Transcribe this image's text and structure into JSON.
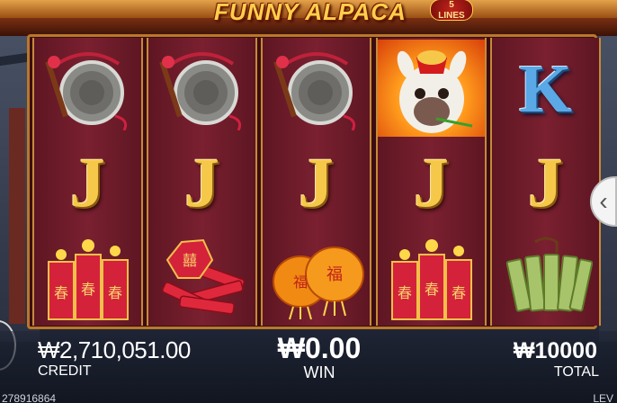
{
  "game": {
    "title": "FUNNY ALPACA",
    "lines_badge": {
      "number": "5",
      "text": "LINES"
    }
  },
  "reels": [
    {
      "symbols": [
        "gong",
        "J",
        "firecrackers"
      ]
    },
    {
      "symbols": [
        "gong",
        "J",
        "firecracker-bundle"
      ]
    },
    {
      "symbols": [
        "gong",
        "J",
        "lanterns"
      ]
    },
    {
      "symbols": [
        "alpaca-wild",
        "J",
        "firecrackers"
      ]
    },
    {
      "symbols": [
        "K",
        "J",
        "jade-tablets"
      ]
    }
  ],
  "hud": {
    "credit_value": "₩2,710,051.00",
    "credit_label": "CREDIT",
    "win_value": "₩0.00",
    "win_label": "WIN",
    "total_value": "₩10000",
    "total_label": "TOTAL"
  },
  "footer": {
    "session_id": "278916864",
    "right_text": "LEV"
  },
  "colors": {
    "gold": "#f6c84a",
    "reel_bg": "#7a2030",
    "frame": "#b9782a",
    "k_blue": "#5aa8e6"
  }
}
